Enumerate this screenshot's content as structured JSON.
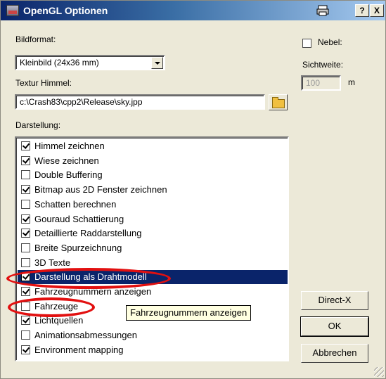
{
  "window": {
    "title": "OpenGL Optionen",
    "help_label": "?",
    "close_label": "X"
  },
  "bildformat": {
    "label": "Bildformat:",
    "value": "Kleinbild (24x36 mm)"
  },
  "textur": {
    "label": "Textur Himmel:",
    "value": "c:\\Crash83\\cpp2\\Release\\sky.jpp"
  },
  "nebel": {
    "label": "Nebel:",
    "checked": false
  },
  "sichtweite": {
    "label": "Sichtweite:",
    "value": "100",
    "unit": "m"
  },
  "darstellung": {
    "label": "Darstellung:",
    "items": [
      {
        "label": "Himmel zeichnen",
        "checked": true
      },
      {
        "label": "Wiese zeichnen",
        "checked": true
      },
      {
        "label": "Double Buffering",
        "checked": false
      },
      {
        "label": "Bitmap aus 2D Fenster zeichnen",
        "checked": true
      },
      {
        "label": "Schatten berechnen",
        "checked": false
      },
      {
        "label": "Gouraud Schattierung",
        "checked": true
      },
      {
        "label": "Detaillierte Raddarstellung",
        "checked": true
      },
      {
        "label": "Breite Spurzeichnung",
        "checked": false
      },
      {
        "label": "3D Texte",
        "checked": false
      },
      {
        "label": "Darstellung als Drahtmodell",
        "checked": true,
        "selected": true
      },
      {
        "label": "Fahrzeugnummern anzeigen",
        "checked": true
      },
      {
        "label": "Fahrzeuge",
        "checked": false
      },
      {
        "label": "Lichtquellen",
        "checked": true
      },
      {
        "label": "Animationsabmessungen",
        "checked": false
      },
      {
        "label": "Environment mapping",
        "checked": true
      }
    ]
  },
  "tooltip": "Fahrzeugnummern anzeigen",
  "buttons": {
    "directx": "Direct-X",
    "ok": "OK",
    "cancel": "Abbrechen"
  },
  "icons": {
    "app": "app-icon",
    "print": "print-icon",
    "folder": "folder-open-icon",
    "resize": "resize-grip-icon"
  },
  "colors": {
    "selection": "#0a246a",
    "annotation": "#e21010",
    "tooltip": "#ffffe1",
    "dialog": "#ece9d8"
  }
}
